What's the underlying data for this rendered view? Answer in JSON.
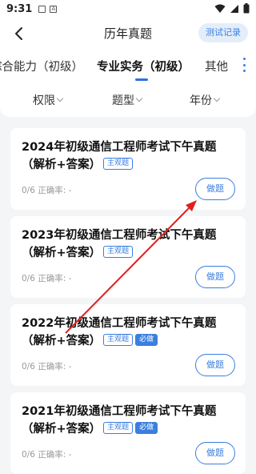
{
  "status": {
    "time": "9:31"
  },
  "header": {
    "title": "历年真题",
    "record_label": "测试记录"
  },
  "tabs": [
    {
      "label": "综合能力（初级）"
    },
    {
      "label": "专业实务（初级）"
    },
    {
      "label": "其他"
    }
  ],
  "filters": [
    {
      "label": "权限"
    },
    {
      "label": "题型"
    },
    {
      "label": "年份"
    }
  ],
  "cards": [
    {
      "title": "2024年初级通信工程师考试下午真题（解析+答案）",
      "tags": [
        "主观题"
      ],
      "progress": "0/6",
      "accuracy": "正确率: -",
      "button_label": "做题"
    },
    {
      "title": "2023年初级通信工程师考试下午真题（解析+答案）",
      "tags": [
        "主观题"
      ],
      "progress": "0/6",
      "accuracy": "正确率: -",
      "button_label": "做题"
    },
    {
      "title": "2022年初级通信工程师考试下午真题（解析+答案）",
      "tags": [
        "主观题",
        "必做"
      ],
      "progress": "0/6",
      "accuracy": "正确率: -",
      "button_label": "做题"
    },
    {
      "title": "2021年初级通信工程师考试下午真题（解析+答案）",
      "tags": [
        "主观题",
        "必做"
      ],
      "progress": "0/6",
      "accuracy": "正确率: -",
      "button_label": "做题"
    }
  ],
  "colors": {
    "accent": "#3a7fe0",
    "annotation_arrow": "#e02020"
  }
}
